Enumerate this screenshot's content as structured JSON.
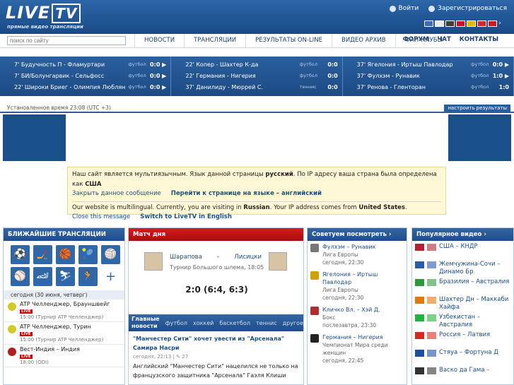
{
  "header": {
    "logo_main": "LIVE",
    "logo_tv": "TV",
    "logo_sub": "прямые видео трансляции",
    "login": "Войти",
    "register": "Зарегистрироваться",
    "flags": [
      "#3a6cc0",
      "#e8e8e8",
      "#3d3d3d",
      "#c8102e",
      "#e3b800",
      "#d02b2b",
      "#c81d1d"
    ]
  },
  "search": {
    "placeholder": "поиск по сайту"
  },
  "menu": [
    "НОВОСТИ",
    "ТРАНСЛЯЦИИ",
    "РЕЗУЛЬТАТЫ ON-LINE",
    "ВИДЕО АРХИВ",
    "ФАН-КЛУБЫ"
  ],
  "menu2": [
    "ФОРУМ",
    "ЧАТ",
    "КОНТАКТЫ"
  ],
  "ticker": [
    [
      {
        "t": "7' Будучность П - Фламуртари",
        "s": "футбол",
        "sc": "0:0 ▶"
      },
      {
        "t": "7' БИ/Болунгарвик - Сельфосс",
        "s": "футбол",
        "sc": "0:0 ▶"
      },
      {
        "t": "22' Широки Бриег - Олимпия Люблян",
        "s": "футбол",
        "sc": "0:0 ▶"
      }
    ],
    [
      {
        "t": "22' Копер - Шахтер К-да",
        "s": "футбол",
        "sc": "0:0"
      },
      {
        "t": "22' Германия - Нигерия",
        "s": "футбол",
        "sc": "0:0"
      },
      {
        "t": "37' Данилиду - Мюррей С.",
        "s": "теннис",
        "sc": "0:0"
      }
    ],
    [
      {
        "t": "37' Ягелония - Иртыш Павлодар",
        "s": "футбол",
        "sc": "0:0 ▶"
      },
      {
        "t": "37' Фулхэм - Рунавик",
        "s": "футбол",
        "sc": "1:0 ▶"
      },
      {
        "t": "37' Ренова - Гленторан",
        "s": "футбол",
        "sc": "1:0"
      }
    ]
  ],
  "timebar": {
    "text": "Установленное время 23:08 (UTC +3)",
    "button": "настроить результаты"
  },
  "notice": {
    "ru_text_1": "Наш сайт является мультиязычным. Язык данной страницы ",
    "ru_lang": "русский",
    "ru_text_2": ". По IP адресу ваша страна была определена как ",
    "ru_country": "США",
    "ru_close": "Закрыть данное сообщение",
    "ru_switch": "Перейти к странице на языке – английский",
    "en_text_1": "Our website is multilingual. Currently, you are visiting in ",
    "en_lang": "Russian",
    "en_text_2": ". Your IP address comes from ",
    "en_country": "United States",
    "en_close": "Close this message",
    "en_switch": "Switch to LiveTV in English"
  },
  "left": {
    "title": "БЛИЖАЙШИЕ ТРАНСЛЯЦИИ",
    "today": "сегодня (30 июня, четверг)",
    "live": "LIVE",
    "events": [
      {
        "name": "ATP Челленджер, Брауншвейг",
        "time": "15:00 (Турнир ATP Челленджер)",
        "color": "#d4c92a"
      },
      {
        "name": "ATP Челленджер, Турин",
        "time": "15:00 (Турнир ATP Челленджер)",
        "color": "#d4c92a"
      },
      {
        "name": "Вест-Индия – Индия",
        "time": "18:00 (ODI)",
        "color": "#b02020"
      }
    ]
  },
  "center": {
    "title": "Матч дня",
    "p1": "Шарапова",
    "dash": "–",
    "p2": "Лисицки",
    "tour": "Турнир Большого шлема, 18:05",
    "score": "2:0 (6:4, 6:3)",
    "news_h": "Главные новости",
    "cats": [
      "футбол",
      "хоккей",
      "баскетбол",
      "теннис",
      "другое"
    ],
    "news_title": "\"Манчестер Сити\" хочет увести из \"Арсенала\" Самира Насри",
    "news_meta": "сегодня, 22:13 | ✎ 27",
    "news_text": "Английский \"Манчестер Сити\" нацелился не только на французского защитника \"Арсенала\" Гаэля Клиши"
  },
  "rec": {
    "title": "Советуем посмотреть",
    "items": [
      {
        "m": "Фулхэм – Рунавик",
        "l": "Лига Европы",
        "d": "сегодня, 22:30",
        "c": "#777"
      },
      {
        "m": "Ягелония – Иртыш Павлодар",
        "l": "Лига Европы",
        "d": "сегодня, 22:30",
        "c": "#d4a000"
      },
      {
        "m": "Кличко Вл. – Хэй Д.",
        "l": "Бокс",
        "d": "послезавтра, 23:30",
        "c": "#b03030"
      },
      {
        "m": "Германия – Нигерия",
        "l": "Чемпионат Мира среди женщин",
        "d": "сегодня, 22:45",
        "c": "#222"
      }
    ]
  },
  "pop": {
    "title": "Популярное видео",
    "items": [
      {
        "t": "США – КНДР",
        "c": "#b22234"
      },
      {
        "t": "Жемчужина-Сочи – Динамо Бр",
        "c": "#2a5caa"
      },
      {
        "t": "Бразилия – Австралия",
        "c": "#2c9a3a"
      },
      {
        "t": "Шахтер Дн – Маккаби Хайфа",
        "c": "#e07a10"
      },
      {
        "t": "Узбекистан – Австралия",
        "c": "#1eb53a"
      },
      {
        "t": "Россия – Латвия",
        "c": "#d52b1e"
      },
      {
        "t": "Стяуа – Фортуна Д",
        "c": "#1d4fa0"
      },
      {
        "t": "Васко да Гама –",
        "c": "#333"
      }
    ]
  }
}
